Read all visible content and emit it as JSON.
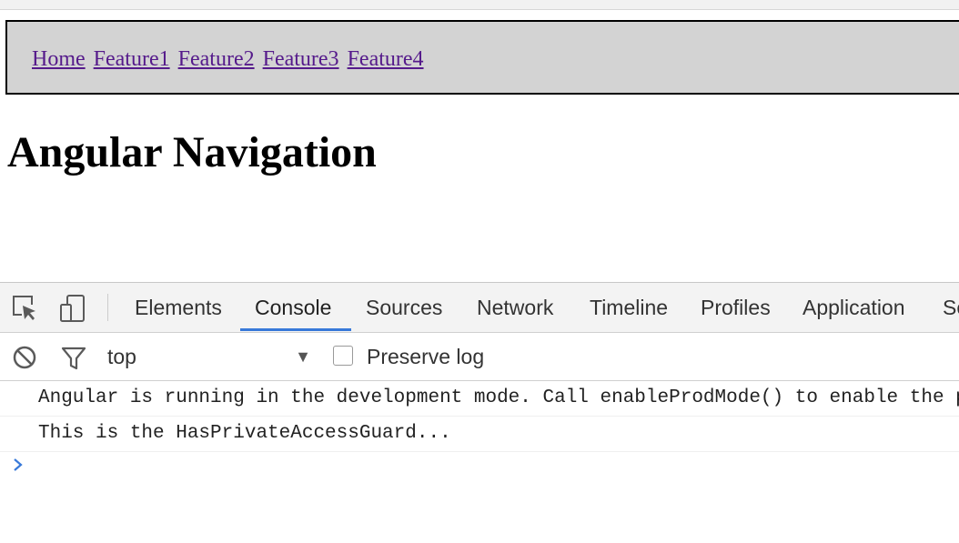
{
  "nav": {
    "links": [
      "Home",
      "Feature1",
      "Feature2",
      "Feature3",
      "Feature4"
    ]
  },
  "page": {
    "title": "Angular Navigation"
  },
  "devtools": {
    "toolbar_icons": [
      "inspect-element-icon",
      "device-mode-icon"
    ],
    "tabs": [
      "Elements",
      "Console",
      "Sources",
      "Network",
      "Timeline",
      "Profiles",
      "Application",
      "Se"
    ],
    "active_tab": "Console",
    "accent_color": "#3879d9",
    "filterbar": {
      "clear_icon": "clear-console-icon",
      "filter_icon": "filter-icon",
      "context_value": "top",
      "dropdown_icon": "dropdown-arrow-icon",
      "preserve_log_label": "Preserve log",
      "preserve_log_checked": false
    },
    "console_messages": [
      "Angular is running in the development mode. Call enableProdMode() to enable the production mode.",
      "This is the HasPrivateAccessGuard..."
    ],
    "prompt_icon": "console-prompt-icon"
  }
}
